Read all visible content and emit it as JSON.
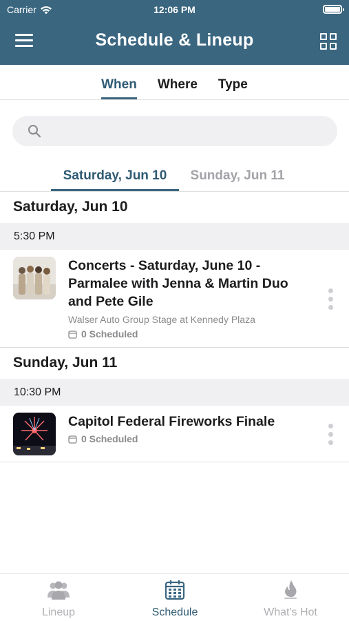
{
  "status_bar": {
    "carrier": "Carrier",
    "time": "12:06 PM",
    "battery_level": 1.0
  },
  "header": {
    "title": "Schedule & Lineup",
    "menu_icon": "hamburger-menu-icon",
    "grid_icon": "grid-view-icon",
    "color": "#3a6680"
  },
  "subtabs": [
    {
      "label": "When",
      "active": true
    },
    {
      "label": "Where",
      "active": false
    },
    {
      "label": "Type",
      "active": false
    }
  ],
  "search": {
    "placeholder": "",
    "value": ""
  },
  "day_tabs": [
    {
      "label": "Saturday, Jun 10",
      "active": true
    },
    {
      "label": "Sunday, Jun 11",
      "active": false
    }
  ],
  "sections": [
    {
      "day": "Saturday, Jun 10",
      "time": "5:30 PM",
      "event": {
        "title": "Concerts - Saturday, June 10 - Parmalee with Jenna & Martin Duo and Pete Gile",
        "location": "Walser Auto Group Stage at Kennedy Plaza",
        "scheduled": "0 Scheduled"
      }
    },
    {
      "day": "Sunday, Jun 11",
      "time": "10:30 PM",
      "event": {
        "title": "Capitol Federal Fireworks Finale",
        "location": "",
        "scheduled": "0 Scheduled"
      }
    }
  ],
  "tab_bar": [
    {
      "label": "Lineup",
      "icon": "people-icon",
      "active": false
    },
    {
      "label": "Schedule",
      "icon": "calendar-icon",
      "active": true
    },
    {
      "label": "What's Hot",
      "icon": "flame-icon",
      "active": false
    }
  ],
  "colors": {
    "accent": "#3a6680",
    "accent_text": "#2f5a73",
    "muted": "#8a8a8e"
  }
}
